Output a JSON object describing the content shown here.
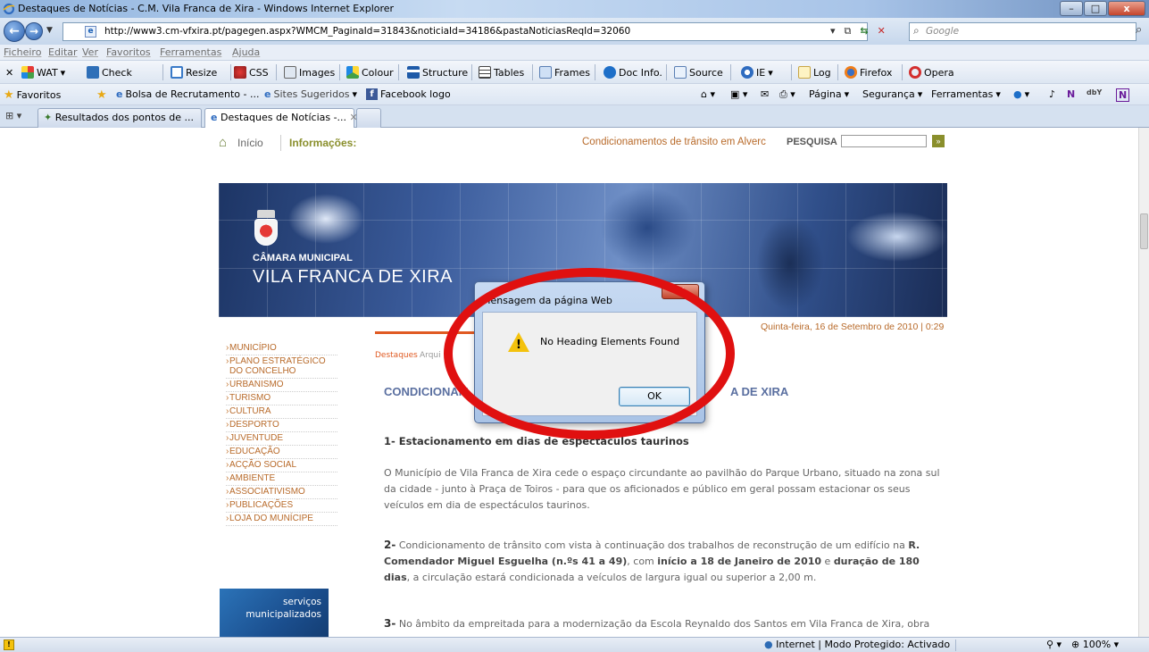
{
  "window": {
    "title": "Destaques de Notícias - C.M. Vila Franca de Xira - Windows Internet Explorer"
  },
  "address_bar": {
    "url": "http://www3.cm-vfxira.pt/pagegen.aspx?WMCM_PaginaId=31843&noticiaId=34186&pastaNoticiasReqId=32060",
    "search_placeholder": "Google"
  },
  "menu": [
    "Ficheiro",
    "Editar",
    "Ver",
    "Favoritos",
    "Ferramentas",
    "Ajuda"
  ],
  "wat_toolbar": {
    "items": [
      "WAT",
      "Check",
      "Resize",
      "CSS",
      "Images",
      "Colour",
      "Structure",
      "Tables",
      "Frames",
      "Doc Info.",
      "Source",
      "IE",
      "Log",
      "Firefox",
      "Opera"
    ]
  },
  "favorites_bar": {
    "favorites_label": "Favoritos",
    "links": [
      "Bolsa de Recrutamento - ...",
      "Sites Sugeridos",
      "Facebook logo"
    ],
    "commands": [
      "Página",
      "Segurança",
      "Ferramentas"
    ]
  },
  "tabs": [
    "Resultados dos pontos de ...",
    "Destaques de Notícias -..."
  ],
  "site": {
    "home_label": "Início",
    "info_label": "Informações:",
    "ticker": "Condicionamentos de trânsito em Alverc",
    "search_label": "PESQUISA",
    "search_go": "»",
    "banner_small": "CÂMARA MUNICIPAL",
    "banner_big": "VILA FRANCA DE XIRA",
    "date": "Quinta-feira, 16 de Setembro de 2010 | 0:29",
    "nav": [
      "MUNICÍPIO",
      "PLANO ESTRATÉGICO DO CONCELHO",
      "URBANISMO",
      "TURISMO",
      "CULTURA",
      "DESPORTO",
      "JUVENTUDE",
      "EDUCAÇÃO",
      "ACÇÃO SOCIAL",
      "AMBIENTE",
      "ASSOCIATIVISMO",
      "PUBLICAÇÕES",
      "LOJA DO MUNÍCIPE"
    ],
    "servicos_line1": "serviços",
    "servicos_line2": "municipalizados",
    "content_tabs": [
      "Destaques",
      "Arqui"
    ],
    "heading": "CONDICIONAM",
    "heading_tail": "A DE XIRA",
    "p_sub": "1- Estacionamento em dias de espectáculos taurinos",
    "p1": "O Município de Vila Franca de Xira cede o espaço circundante ao pavilhão do Parque Urbano, situado na zona sul da cidade - junto à Praça de Toiros - para que os aficionados e público em geral possam estacionar os seus veículos em dia de espectáculos taurinos.",
    "p2_num": "2-",
    "p2_a": " Condicionamento de trânsito com vista à continuação dos trabalhos de reconstrução de um edifício na ",
    "p2_b": "R. Comendador Miguel Esguelha (n.ºs 41 a 49)",
    "p2_c": ", com ",
    "p2_d": "início a 18 de Janeiro de 2010",
    "p2_e": " e ",
    "p2_f": "duração de 180 dias",
    "p2_g": ", a circulação estará condicionada a veículos de largura igual ou superior a 2,00 m.",
    "p3_num": "3-",
    "p3": " No âmbito da empreitada para a modernização da Escola Reynaldo dos Santos em Vila Franca de Xira, obra"
  },
  "dialog": {
    "title": "Mensagem da página Web",
    "message": "No Heading Elements Found",
    "ok": "OK",
    "close": "X"
  },
  "status_bar": {
    "zone": "Internet | Modo Protegido: Activado",
    "zoom": "100%"
  },
  "colors": {
    "annotation": "#e01010",
    "site_accent": "#b86a2a",
    "heading": "#5a6fa0"
  }
}
